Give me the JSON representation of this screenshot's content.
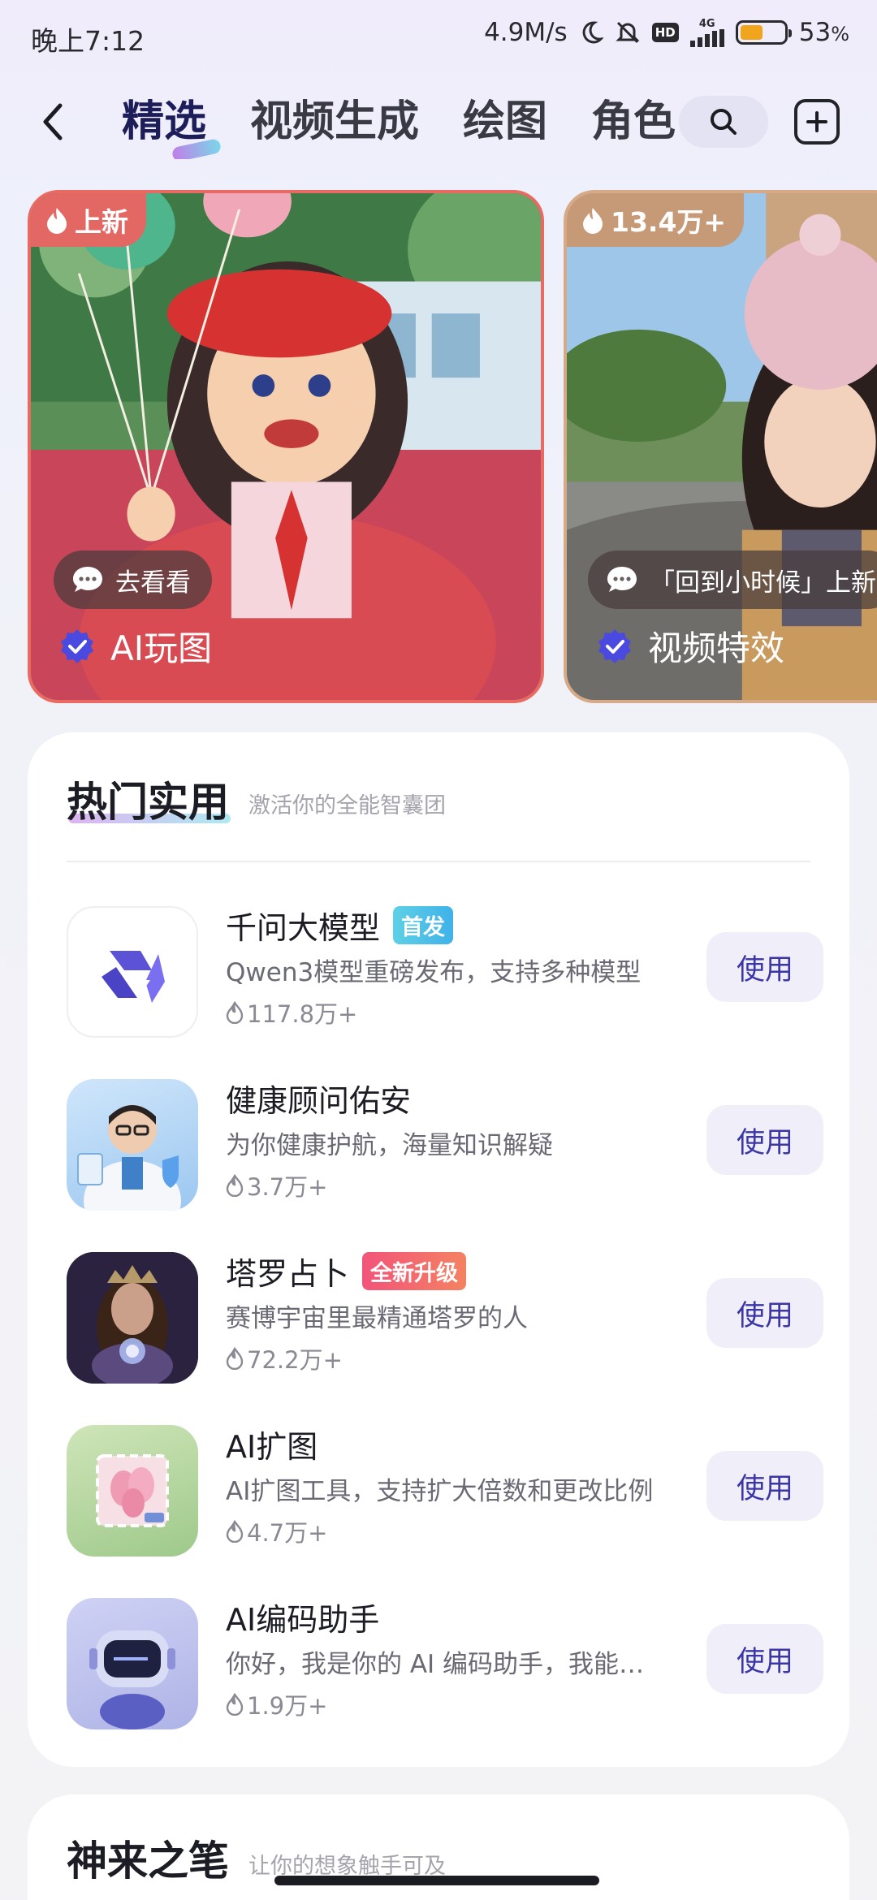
{
  "status_bar": {
    "time": "晚上7:12",
    "net_speed": "4.9M/s",
    "hd": "HD",
    "network": "4G",
    "battery": "53",
    "battery_unit": "%",
    "battery_level": 0.53
  },
  "nav": {
    "tabs": [
      {
        "label": "精选",
        "active": true
      },
      {
        "label": "视频生成",
        "active": false
      },
      {
        "label": "绘图",
        "active": false
      },
      {
        "label": "角色",
        "active": false
      }
    ]
  },
  "banners": [
    {
      "badge": "上新",
      "button": "去看看",
      "label": "AI玩图",
      "color": "#e3746f"
    },
    {
      "badge": "13.4万+",
      "button": "「回到小时候」上新",
      "label": "视频特效",
      "color": "#c79a78"
    }
  ],
  "hot": {
    "title": "热门实用",
    "subtitle": "激活你的全能智囊团",
    "items": [
      {
        "name": "千问大模型",
        "tag": "首发",
        "desc": "Qwen3模型重磅发布，支持多种模型",
        "count": "117.8万+",
        "button": "使用"
      },
      {
        "name": "健康顾问佑安",
        "tag": "",
        "desc": "为你健康护航，海量知识解疑",
        "count": "3.7万+",
        "button": "使用"
      },
      {
        "name": "塔罗占卜",
        "tag": "全新升级",
        "desc": "赛博宇宙里最精通塔罗的人",
        "count": "72.2万+",
        "button": "使用"
      },
      {
        "name": "AI扩图",
        "tag": "",
        "desc": "AI扩图工具，支持扩大倍数和更改比例",
        "count": "4.7万+",
        "button": "使用"
      },
      {
        "name": "AI编码助手",
        "tag": "",
        "desc": "你好，我是你的 AI 编码助手，我能帮你",
        "count": "1.9万+",
        "button": "使用"
      }
    ]
  },
  "next_section": {
    "title": "神来之笔",
    "subtitle": "让你的想象触手可及"
  },
  "colors": {
    "accent": "#3b36a7",
    "verify": "#4a49e0",
    "tag_new": "#3fb2e9",
    "tag_upgrade": "#f2547a"
  }
}
